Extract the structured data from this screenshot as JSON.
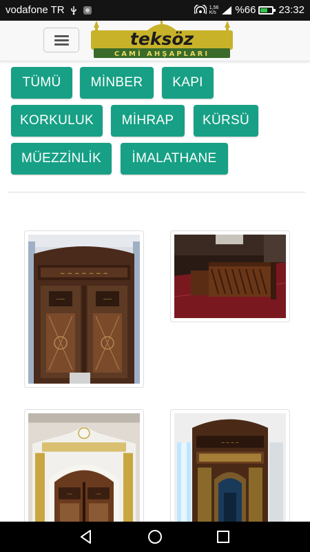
{
  "status_bar": {
    "carrier": "vodafone TR",
    "usb_icon": "usb-icon",
    "notification_icon": "notification-icon",
    "speed": "1,56",
    "speed_unit": "K/s",
    "battery_percent": "%66",
    "battery_level": 0.66,
    "time": "23:32"
  },
  "header": {
    "menu_icon": "hamburger-icon",
    "logo": {
      "name": "teksöz",
      "tagline": "CAMİ AHŞAPLARI",
      "colors": {
        "gold": "#c8b22a",
        "green": "#3a6b2a",
        "dark": "#1c1c1c"
      }
    }
  },
  "filters": [
    {
      "label": "TÜMÜ"
    },
    {
      "label": "MİNBER"
    },
    {
      "label": "KAPI"
    },
    {
      "label": "KORKULUK"
    },
    {
      "label": "MİHRAP"
    },
    {
      "label": "KÜRSÜ"
    },
    {
      "label": "MÜEZZİNLİK"
    },
    {
      "label": "İMALATHANE"
    }
  ],
  "accent_color": "#17a085",
  "gallery": [
    {
      "subject": "carved-wooden-door-photo"
    },
    {
      "subject": "wooden-railing-photo"
    },
    {
      "subject": "ornate-door-white-frame-photo"
    },
    {
      "subject": "wooden-mihrab-photo"
    }
  ],
  "nav_bar": {
    "back_icon": "back-triangle-icon",
    "home_icon": "home-circle-icon",
    "recents_icon": "recents-square-icon"
  }
}
